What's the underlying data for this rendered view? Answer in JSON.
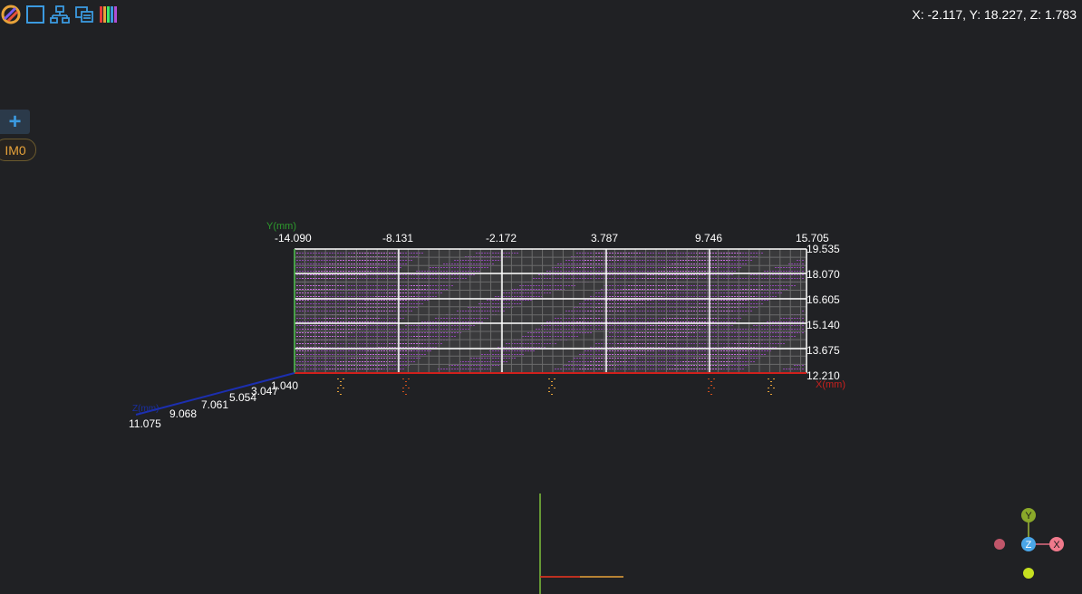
{
  "toolbar": {
    "icons": [
      "palette-icon",
      "square-select-icon",
      "hierarchy-icon",
      "copy-windows-icon",
      "color-bars-icon"
    ]
  },
  "status": {
    "coords": "X: -2.117, Y: 18.227, Z: 1.783"
  },
  "side": {
    "add_symbol": "+",
    "image_tag": "IM0"
  },
  "plot": {
    "x_axis_label": "X(mm)",
    "y_axis_label": "Y(mm)",
    "z_axis_label": "Z(mm)",
    "x_ticks": [
      "-14.090",
      "-8.131",
      "-2.172",
      "3.787",
      "9.746",
      "15.705"
    ],
    "y_ticks": [
      "19.535",
      "18.070",
      "16.605",
      "15.140",
      "13.675",
      "12.210"
    ],
    "z_ticks": [
      "1.040",
      "3.047",
      "5.054",
      "7.061",
      "9.068",
      "11.075"
    ]
  },
  "gizmo": {
    "y_label": "Y",
    "z_label": "Z",
    "x_label": "X"
  },
  "colors": {
    "background": "#202124",
    "x_axis": "#d0201c",
    "y_axis": "#2da02d",
    "z_axis": "#1c2fb0",
    "points": "#b04fd6",
    "accent": "#e8a33a"
  }
}
